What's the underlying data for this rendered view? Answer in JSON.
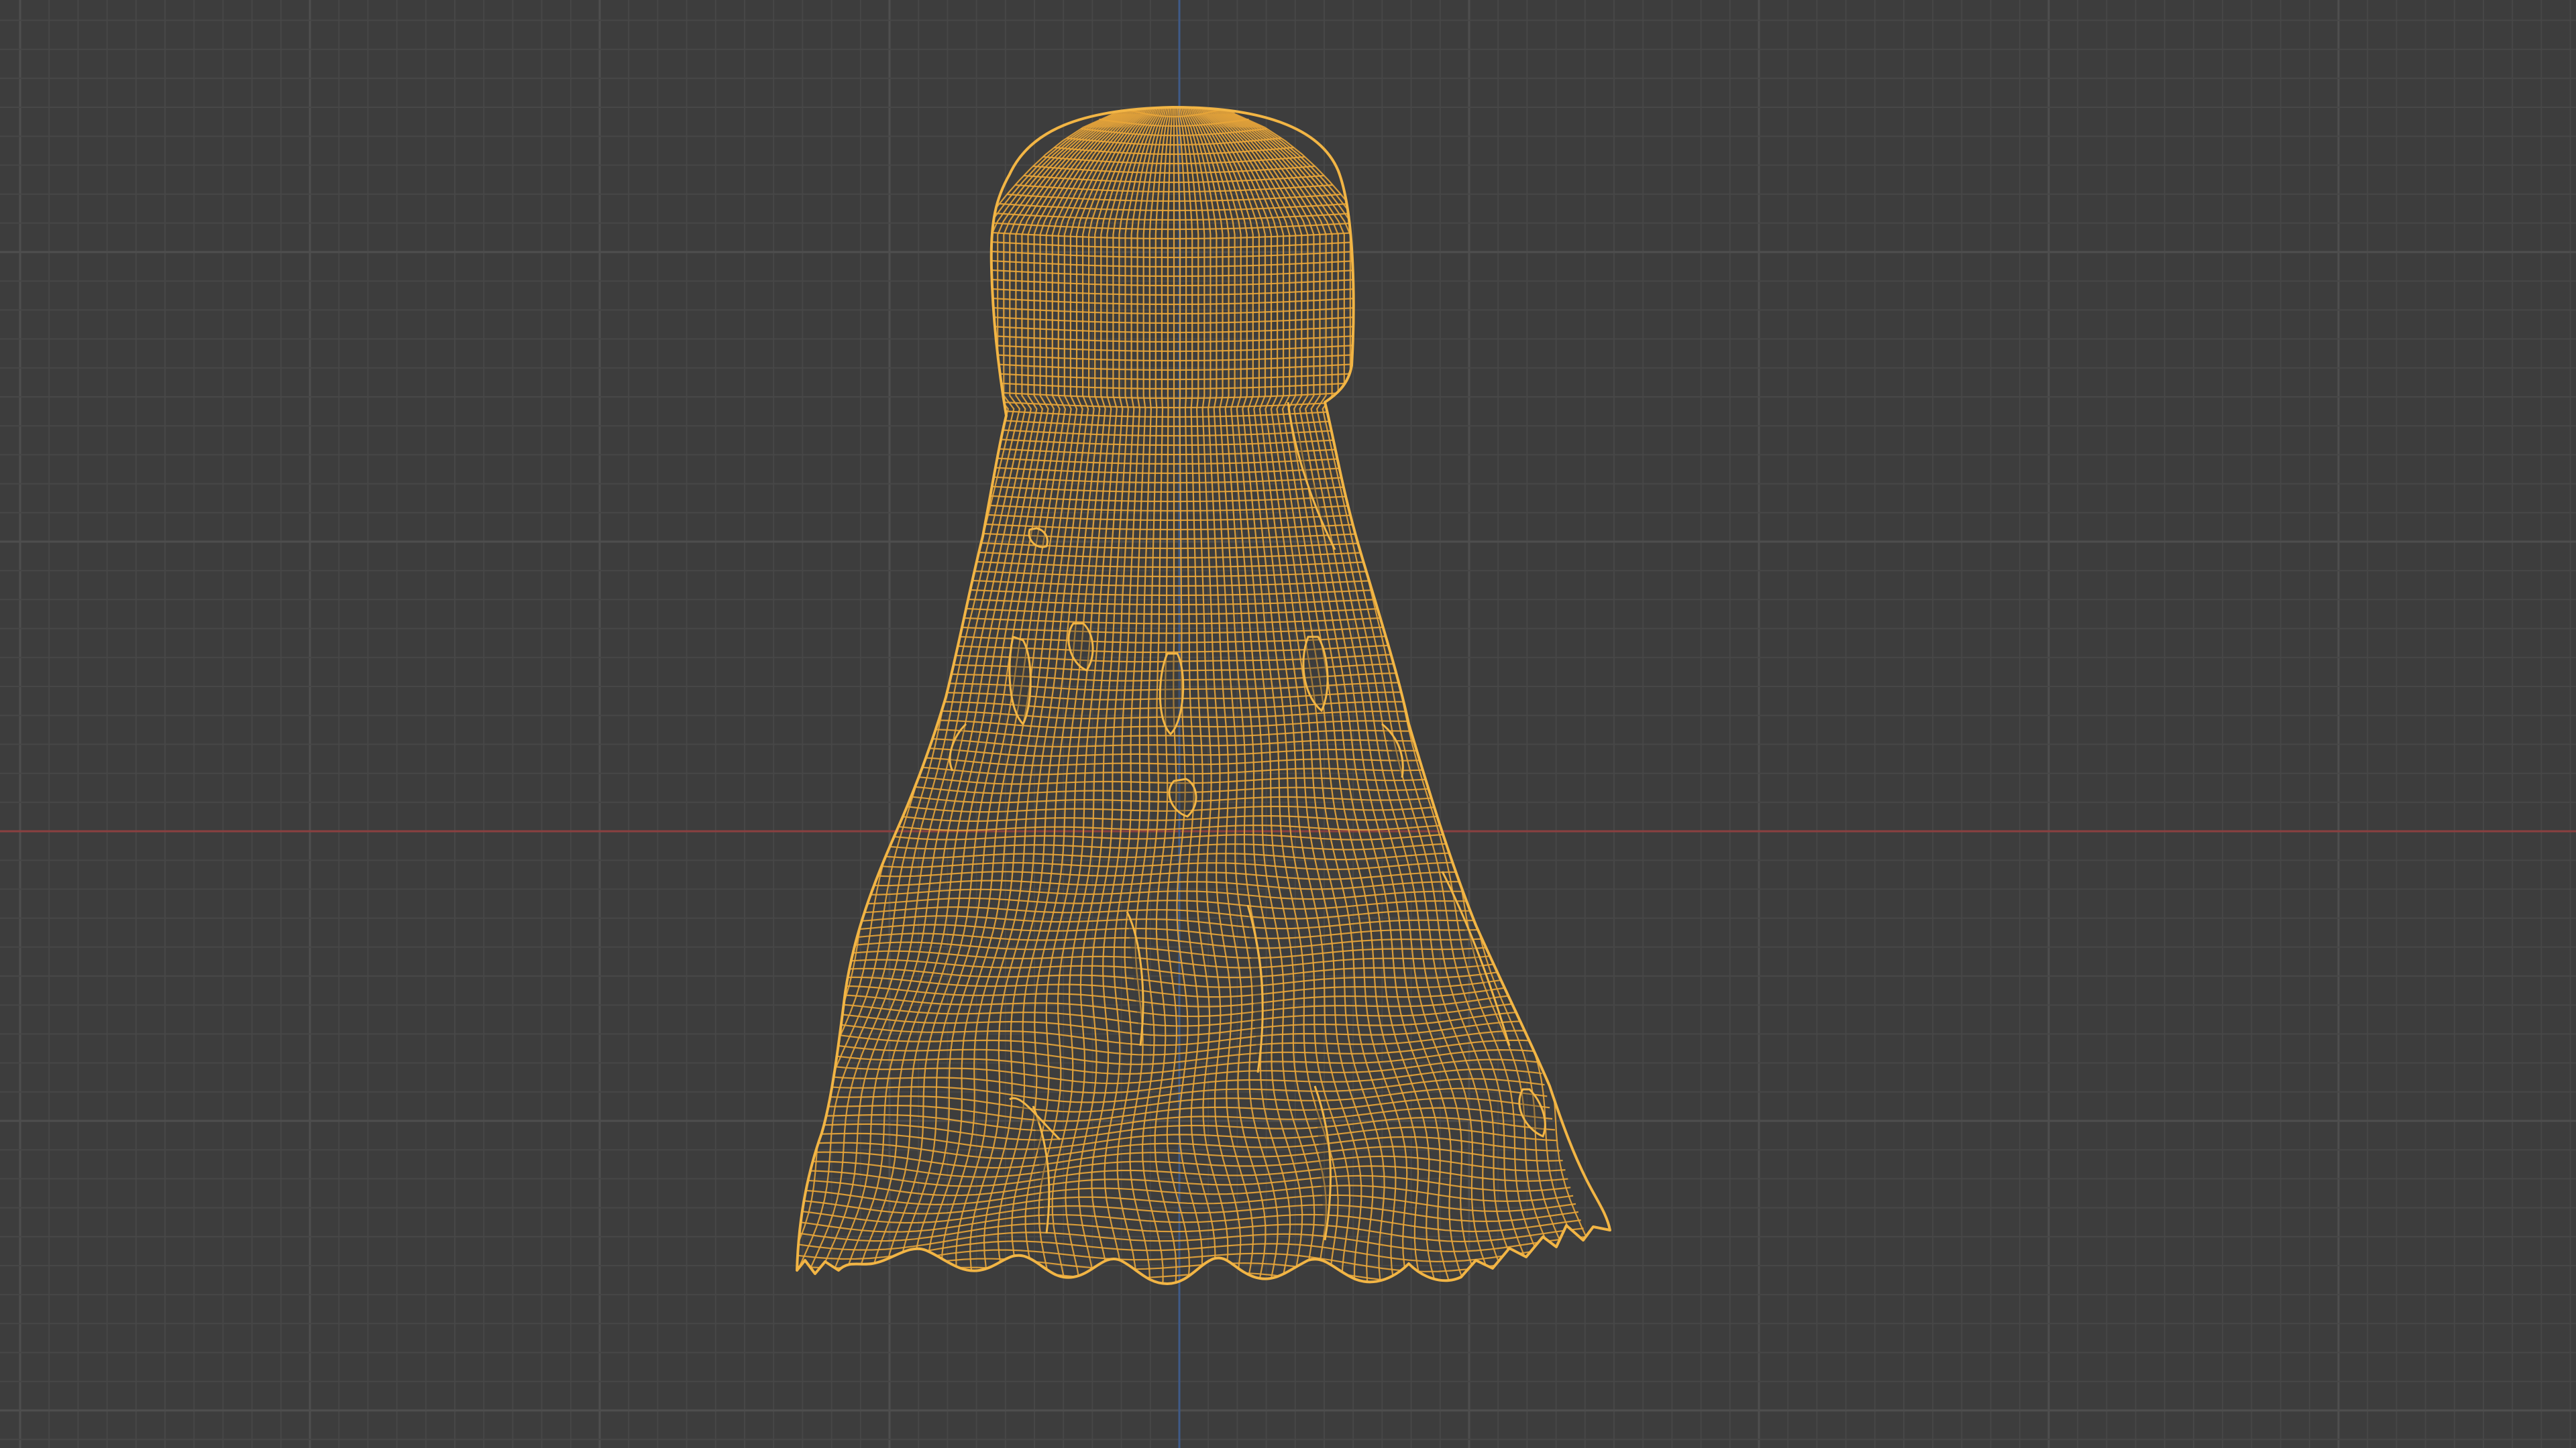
{
  "viewport": {
    "background_color": "#3d3d3d",
    "grid_minor_color": "#474747",
    "grid_major_color": "#4e4e4e",
    "x_axis_color": "#8a4040",
    "y_axis_color": "#3f5a88",
    "shows_grid": true
  },
  "mesh": {
    "object": "ghost-cloth-mesh",
    "display_mode": "wireframe",
    "selected": true,
    "wire_color": "#e8a53a",
    "outline_color": "#f2b545"
  }
}
